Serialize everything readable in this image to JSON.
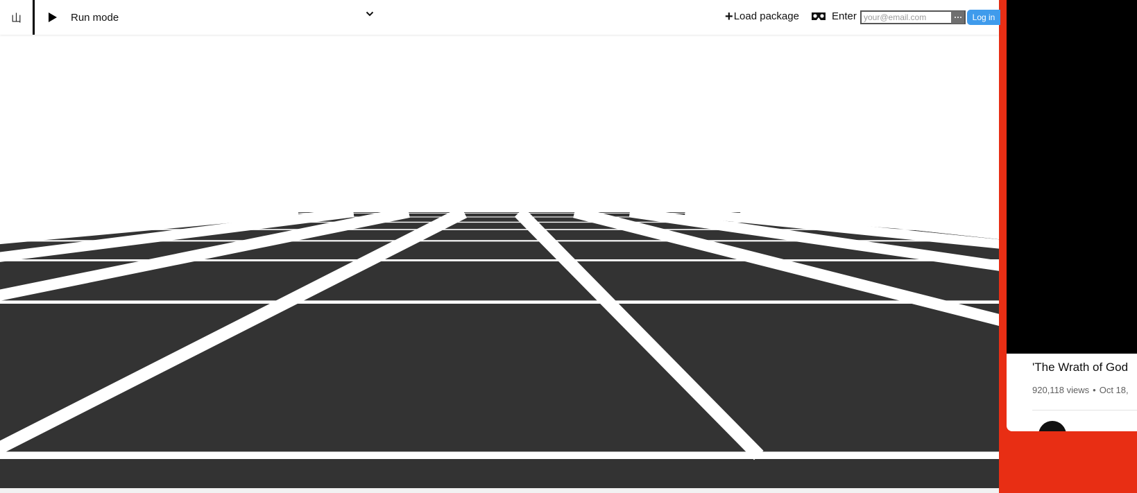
{
  "toolbar": {
    "logo_glyph": "山",
    "mode_label": "Run mode",
    "load_package_label": "Load package",
    "enter_label": "Enter",
    "email_placeholder": "your@email.com",
    "login_label": "Log in",
    "login_color": "#3f9bec"
  },
  "scene": {
    "floor_color": "#333333",
    "grid_line_color": "#ffffff",
    "background": "#ffffff"
  },
  "side_panel": {
    "background": "#e82e14",
    "video_title": "'The Wrath of God",
    "video_views": "920,118 views",
    "video_separator": "•",
    "video_date": "Oct 18,"
  }
}
